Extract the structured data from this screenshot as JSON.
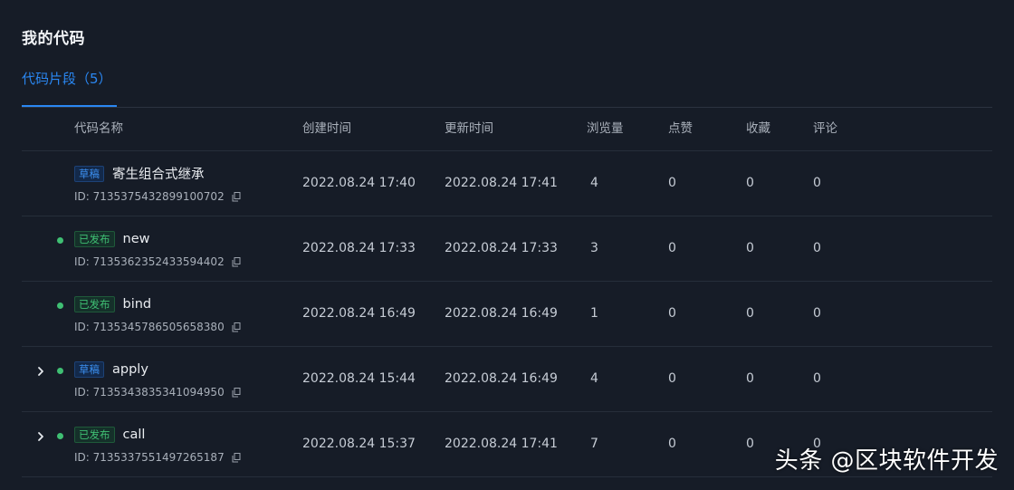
{
  "page": {
    "title": "我的代码"
  },
  "tabs": [
    {
      "label": "代码片段（5）",
      "active": true
    }
  ],
  "table": {
    "columns": [
      "代码名称",
      "创建时间",
      "更新时间",
      "浏览量",
      "点赞",
      "收藏",
      "评论"
    ],
    "rows": [
      {
        "status": "草稿",
        "status_type": "draft",
        "name": "寄生组合式继承",
        "id": "ID: 7135375432899100702",
        "created": "2022.08.24 17:40",
        "updated": "2022.08.24 17:41",
        "views": "4",
        "likes": "0",
        "favorites": "0",
        "comments": "0",
        "has_dot": false,
        "expandable": false
      },
      {
        "status": "已发布",
        "status_type": "published",
        "name": "new",
        "id": "ID: 7135362352433594402",
        "created": "2022.08.24 17:33",
        "updated": "2022.08.24 17:33",
        "views": "3",
        "likes": "0",
        "favorites": "0",
        "comments": "0",
        "has_dot": true,
        "expandable": false
      },
      {
        "status": "已发布",
        "status_type": "published",
        "name": "bind",
        "id": "ID: 7135345786505658380",
        "created": "2022.08.24 16:49",
        "updated": "2022.08.24 16:49",
        "views": "1",
        "likes": "0",
        "favorites": "0",
        "comments": "0",
        "has_dot": true,
        "expandable": false
      },
      {
        "status": "草稿",
        "status_type": "draft",
        "name": "apply",
        "id": "ID: 7135343835341094950",
        "created": "2022.08.24 15:44",
        "updated": "2022.08.24 16:49",
        "views": "4",
        "likes": "0",
        "favorites": "0",
        "comments": "0",
        "has_dot": true,
        "expandable": true
      },
      {
        "status": "已发布",
        "status_type": "published",
        "name": "call",
        "id": "ID: 7135337551497265187",
        "created": "2022.08.24 15:37",
        "updated": "2022.08.24 17:41",
        "views": "7",
        "likes": "0",
        "favorites": "0",
        "comments": "0",
        "has_dot": true,
        "expandable": true
      }
    ]
  },
  "icons": {
    "expand": "chevron-right-icon",
    "copy": "copy-icon",
    "status_dot": "status-dot"
  },
  "colors": {
    "background": "#161c27",
    "accent": "#2a87f2",
    "published": "#3fbf73",
    "draft": "#3b8ff0"
  },
  "watermark": "头条 @区块软件开发"
}
